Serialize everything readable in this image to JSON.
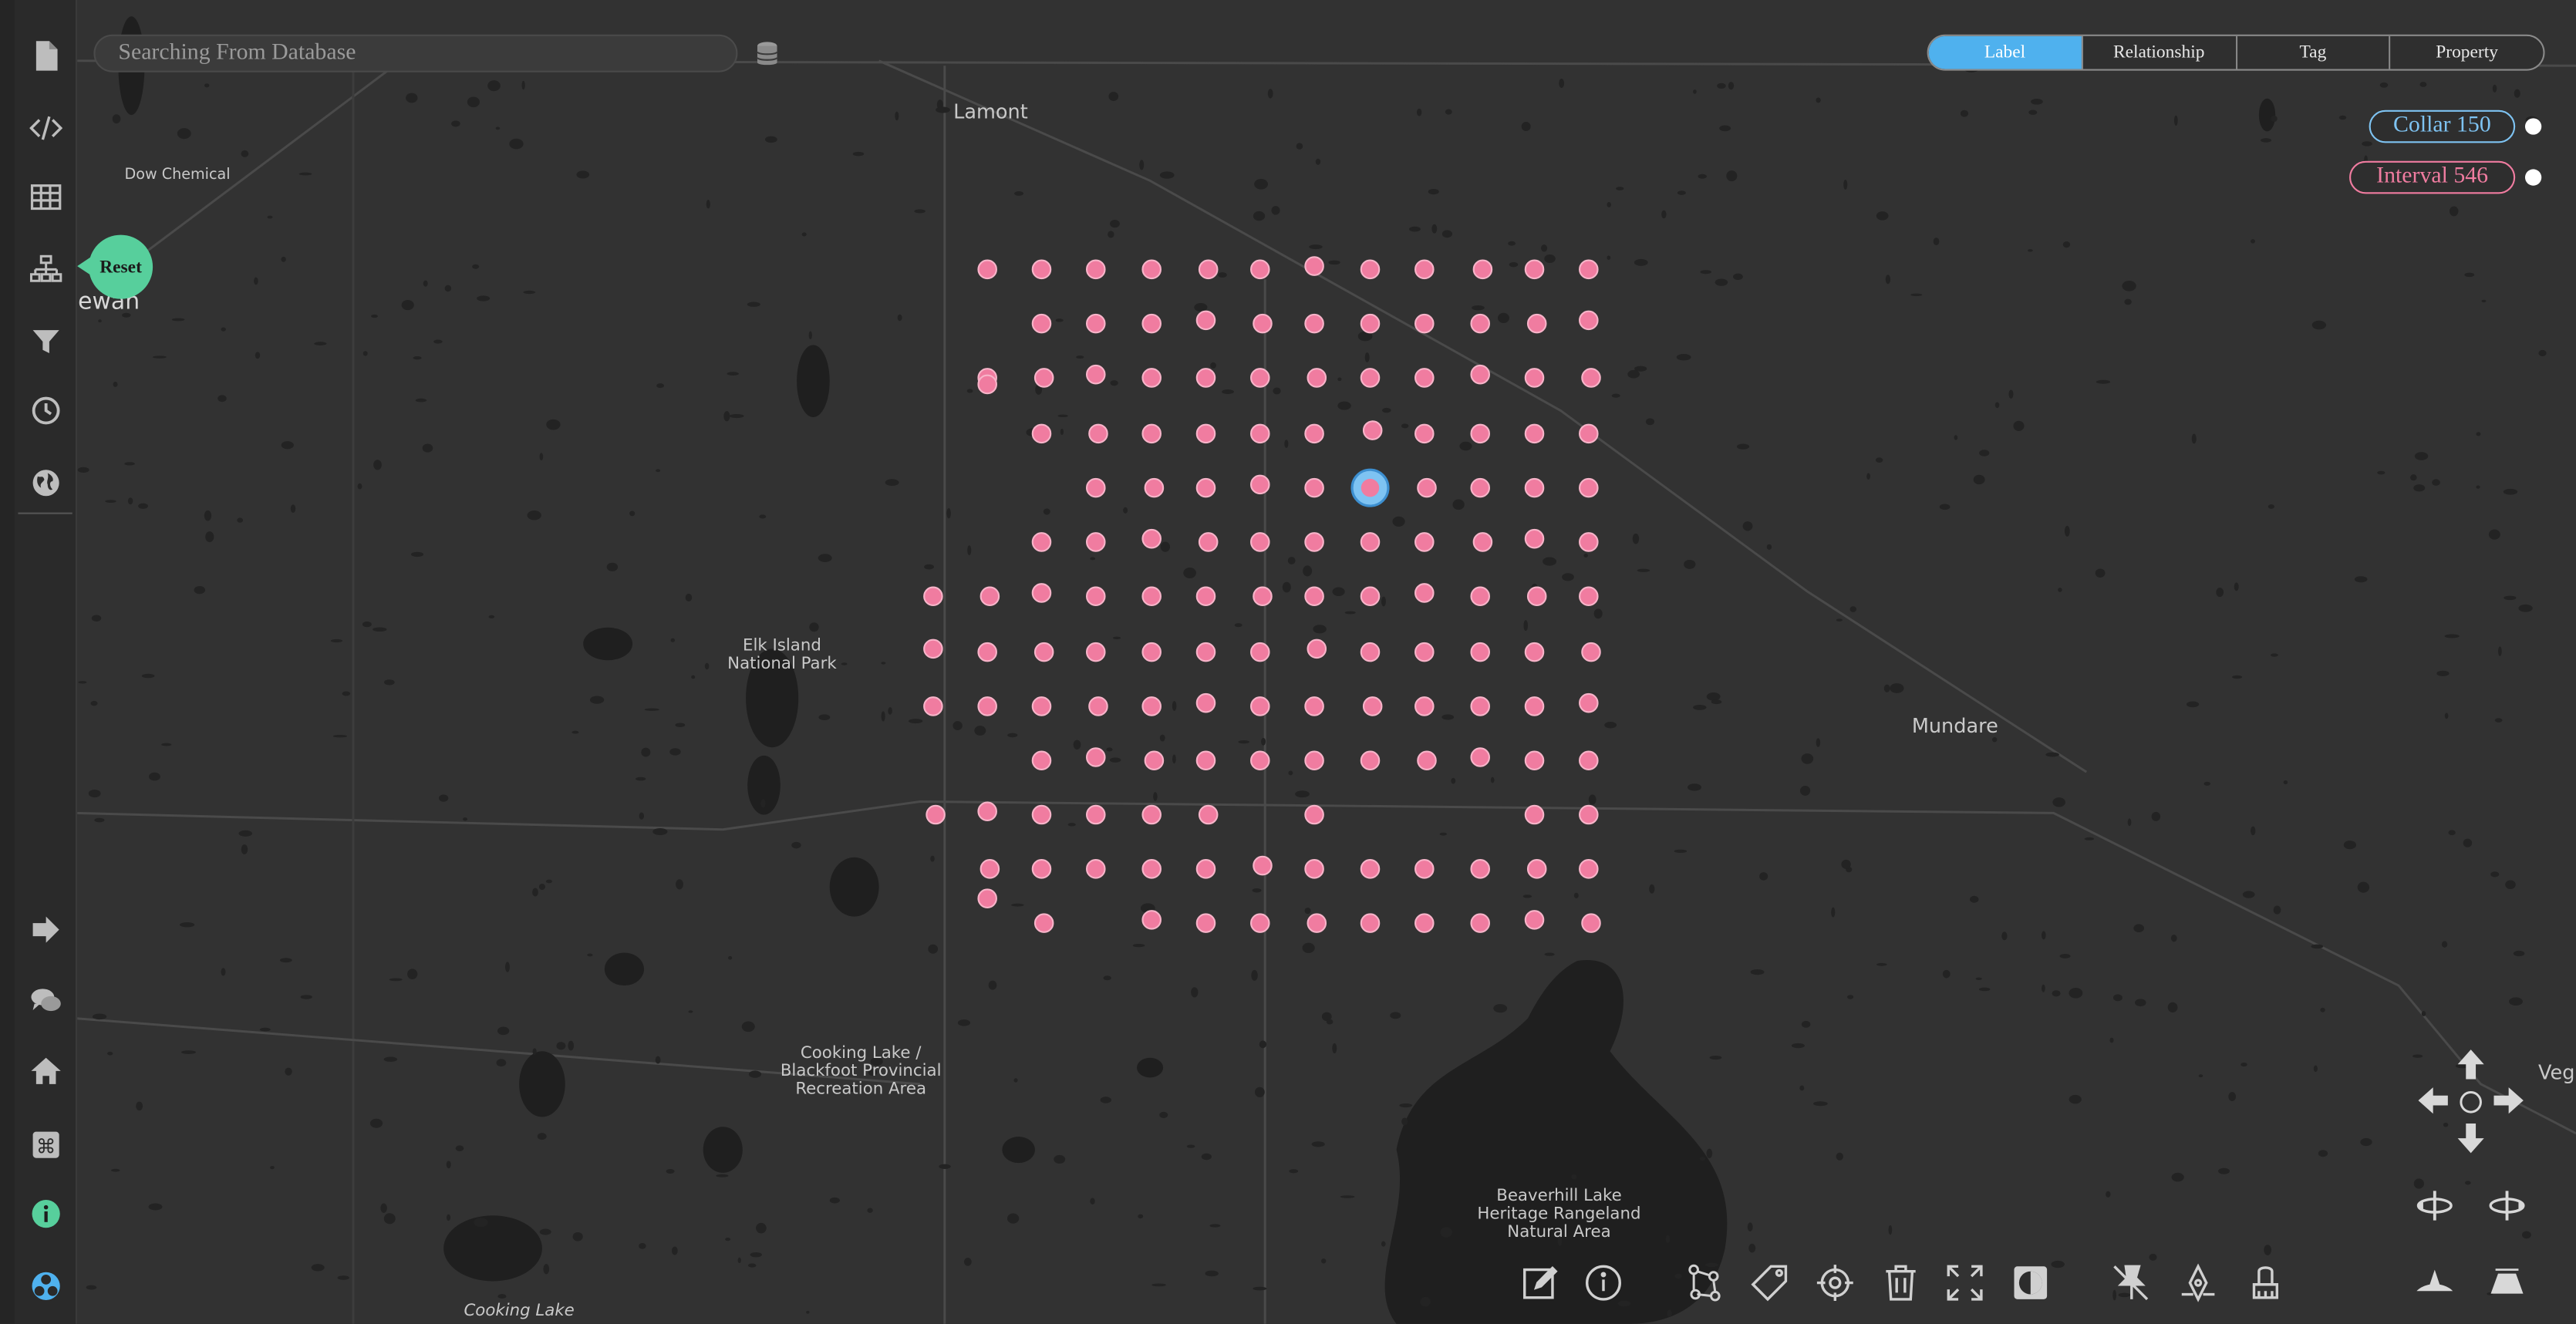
{
  "search": {
    "placeholder": "Searching From Database"
  },
  "tabs": [
    {
      "label": "Label",
      "active": true
    },
    {
      "label": "Relationship",
      "active": false
    },
    {
      "label": "Tag",
      "active": false
    },
    {
      "label": "Property",
      "active": false
    }
  ],
  "legend": [
    {
      "label": "Collar 150",
      "color": "#7ec3f2"
    },
    {
      "label": "Interval 546",
      "color": "#f07ca0"
    }
  ],
  "reset_label": "Reset",
  "map_labels": {
    "lamont": "Lamont",
    "dow": "Dow Chemical",
    "elk1": "Elk Island",
    "elk2": "National Park",
    "mundare": "Mundare",
    "cooking1": "Cooking Lake /",
    "cooking2": "Blackfoot Provincial",
    "cooking3": "Recreation Area",
    "beaver1": "Beaverhill Lake",
    "beaver2": "Heritage Rangeland",
    "beaver3": "Natural Area",
    "cooking_bottom": "Cooking Lake",
    "veg": "Veg",
    "fragment": "katchewan"
  },
  "node_colors": {
    "interval": "#f07ca0",
    "collar": "#7ec3f2"
  },
  "sidebar_top": [
    "file-icon",
    "code-icon",
    "table-icon",
    "graph-schema-icon",
    "filter-icon",
    "clock-icon",
    "globe-icon"
  ],
  "sidebar_bottom": [
    "logout-icon",
    "chat-icon",
    "home-icon",
    "command-icon",
    "info-icon",
    "layout-icon"
  ],
  "bottom_toolbar": [
    "edit-icon",
    "info-circle-icon",
    "hierarchy-icon",
    "tag-icon",
    "target-icon",
    "trash-icon",
    "fullscreen-icon",
    "contrast-icon",
    "pin-off-icon",
    "pen-tool-icon",
    "brush-icon"
  ]
}
